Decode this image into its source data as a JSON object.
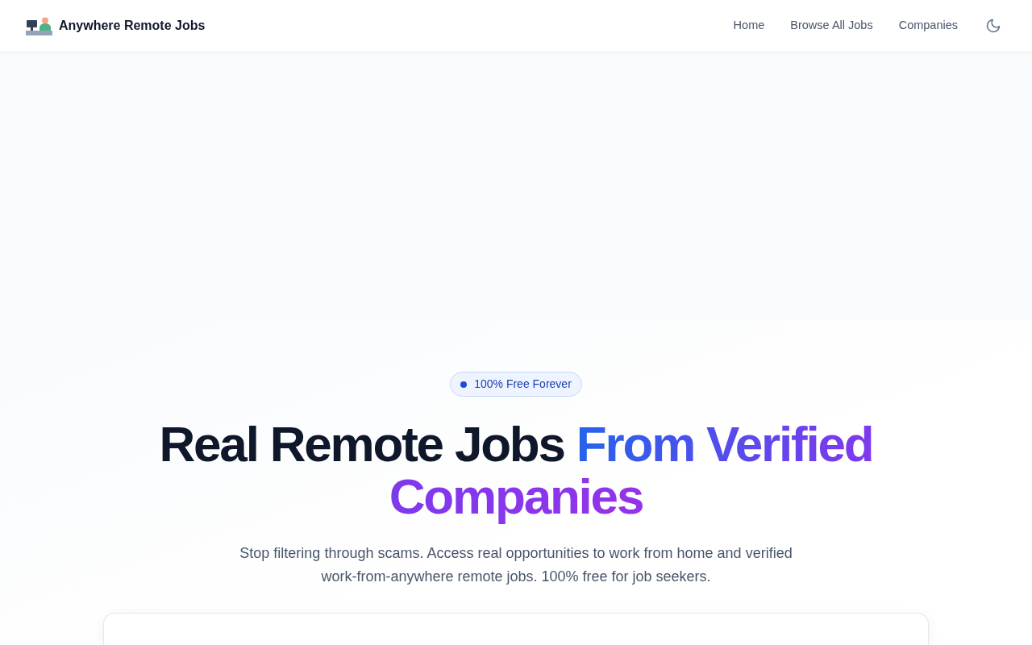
{
  "navbar": {
    "brand": "Anywhere Remote Jobs",
    "links": [
      {
        "label": "Home"
      },
      {
        "label": "Browse All Jobs"
      },
      {
        "label": "Companies"
      }
    ]
  },
  "hero": {
    "badge": "100% Free Forever",
    "title": "Real Remote Jobs",
    "title_highlight": "From Verified Companies",
    "subtitle": "Stop filtering through scams. Access real opportunities to work from home and verified work-from-anywhere remote jobs. 100% free for job seekers."
  }
}
